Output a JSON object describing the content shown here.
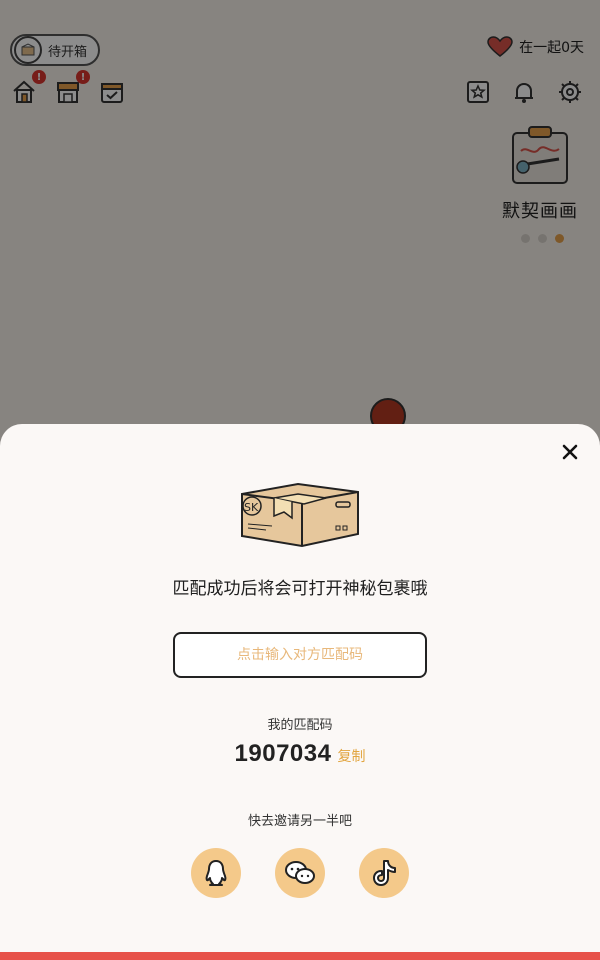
{
  "header": {
    "status_pill_label": "待开箱",
    "together_text": "在一起0天"
  },
  "nav_left": [
    {
      "name": "home",
      "badge": "!"
    },
    {
      "name": "shop",
      "badge": "!"
    },
    {
      "name": "calendar-check",
      "badge": ""
    }
  ],
  "nav_right": [
    "bookmark-star",
    "bell",
    "gear"
  ],
  "widget": {
    "title": "默契画画",
    "pages": 3,
    "active_page": 3
  },
  "modal": {
    "headline": "匹配成功后将会可打开神秘包裹哦",
    "input_placeholder": "点击输入对方匹配码",
    "input_value": "",
    "my_code_label": "我的匹配码",
    "my_code": "1907034",
    "copy_label": "复制",
    "invite_label": "快去邀请另一半吧",
    "share_targets": [
      "qq",
      "wechat",
      "douyin"
    ],
    "box_label": "SK"
  },
  "colors": {
    "accent": "#e2a53f",
    "share_bg": "#f4c98a",
    "placeholder": "#e8b87b",
    "bottom_bar": "#e7524a",
    "badge": "#d9362f"
  }
}
